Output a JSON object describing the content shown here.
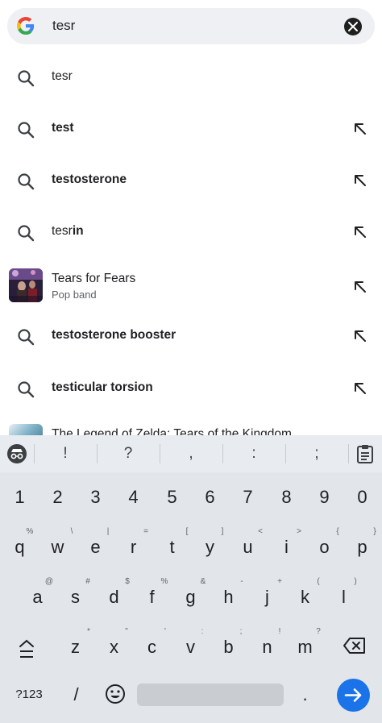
{
  "search": {
    "query": "tesr",
    "logo_icon": "google-g-logo",
    "clear_icon": "close-icon"
  },
  "suggestions": [
    {
      "type": "search",
      "prefix": "tesr",
      "suffix": "",
      "arrow": false
    },
    {
      "type": "search",
      "prefix": "",
      "suffix": "test",
      "arrow": true
    },
    {
      "type": "search",
      "prefix": "",
      "suffix": "testosterone",
      "arrow": true
    },
    {
      "type": "search",
      "prefix": "tesr",
      "suffix": "in",
      "arrow": true
    },
    {
      "type": "entity",
      "title": "Tears for Fears",
      "subtitle": "Pop band",
      "arrow": true
    },
    {
      "type": "search",
      "prefix": "",
      "suffix": "testosterone booster",
      "arrow": true
    },
    {
      "type": "search",
      "prefix": "",
      "suffix": "testicular torsion",
      "arrow": true
    },
    {
      "type": "entity-cut",
      "title": "The Legend of Zelda: Tears of the Kingdom"
    }
  ],
  "keyboard": {
    "top_row": [
      "!",
      "?",
      ",",
      ":",
      ";"
    ],
    "numbers": [
      "1",
      "2",
      "3",
      "4",
      "5",
      "6",
      "7",
      "8",
      "9",
      "0"
    ],
    "row1": {
      "keys": [
        "q",
        "w",
        "e",
        "r",
        "t",
        "y",
        "u",
        "i",
        "o",
        "p"
      ],
      "hints": [
        "%",
        "\\",
        "|",
        "=",
        "[",
        "]",
        "<",
        ">",
        "{",
        "}"
      ]
    },
    "row2": {
      "keys": [
        "a",
        "s",
        "d",
        "f",
        "g",
        "h",
        "j",
        "k",
        "l"
      ],
      "hints": [
        "@",
        "#",
        "$",
        "%",
        "&",
        "-",
        "+",
        "(",
        ")"
      ]
    },
    "row3": {
      "keys": [
        "z",
        "x",
        "c",
        "v",
        "b",
        "n",
        "m"
      ],
      "hints": [
        "*",
        "\"",
        "'",
        ":",
        ";",
        "!",
        "?"
      ]
    },
    "symbols_label": "?123",
    "slash": "/",
    "period": ".",
    "colors": {
      "accent": "#1a73e8",
      "keyboard_bg": "#e2e6ea"
    }
  }
}
